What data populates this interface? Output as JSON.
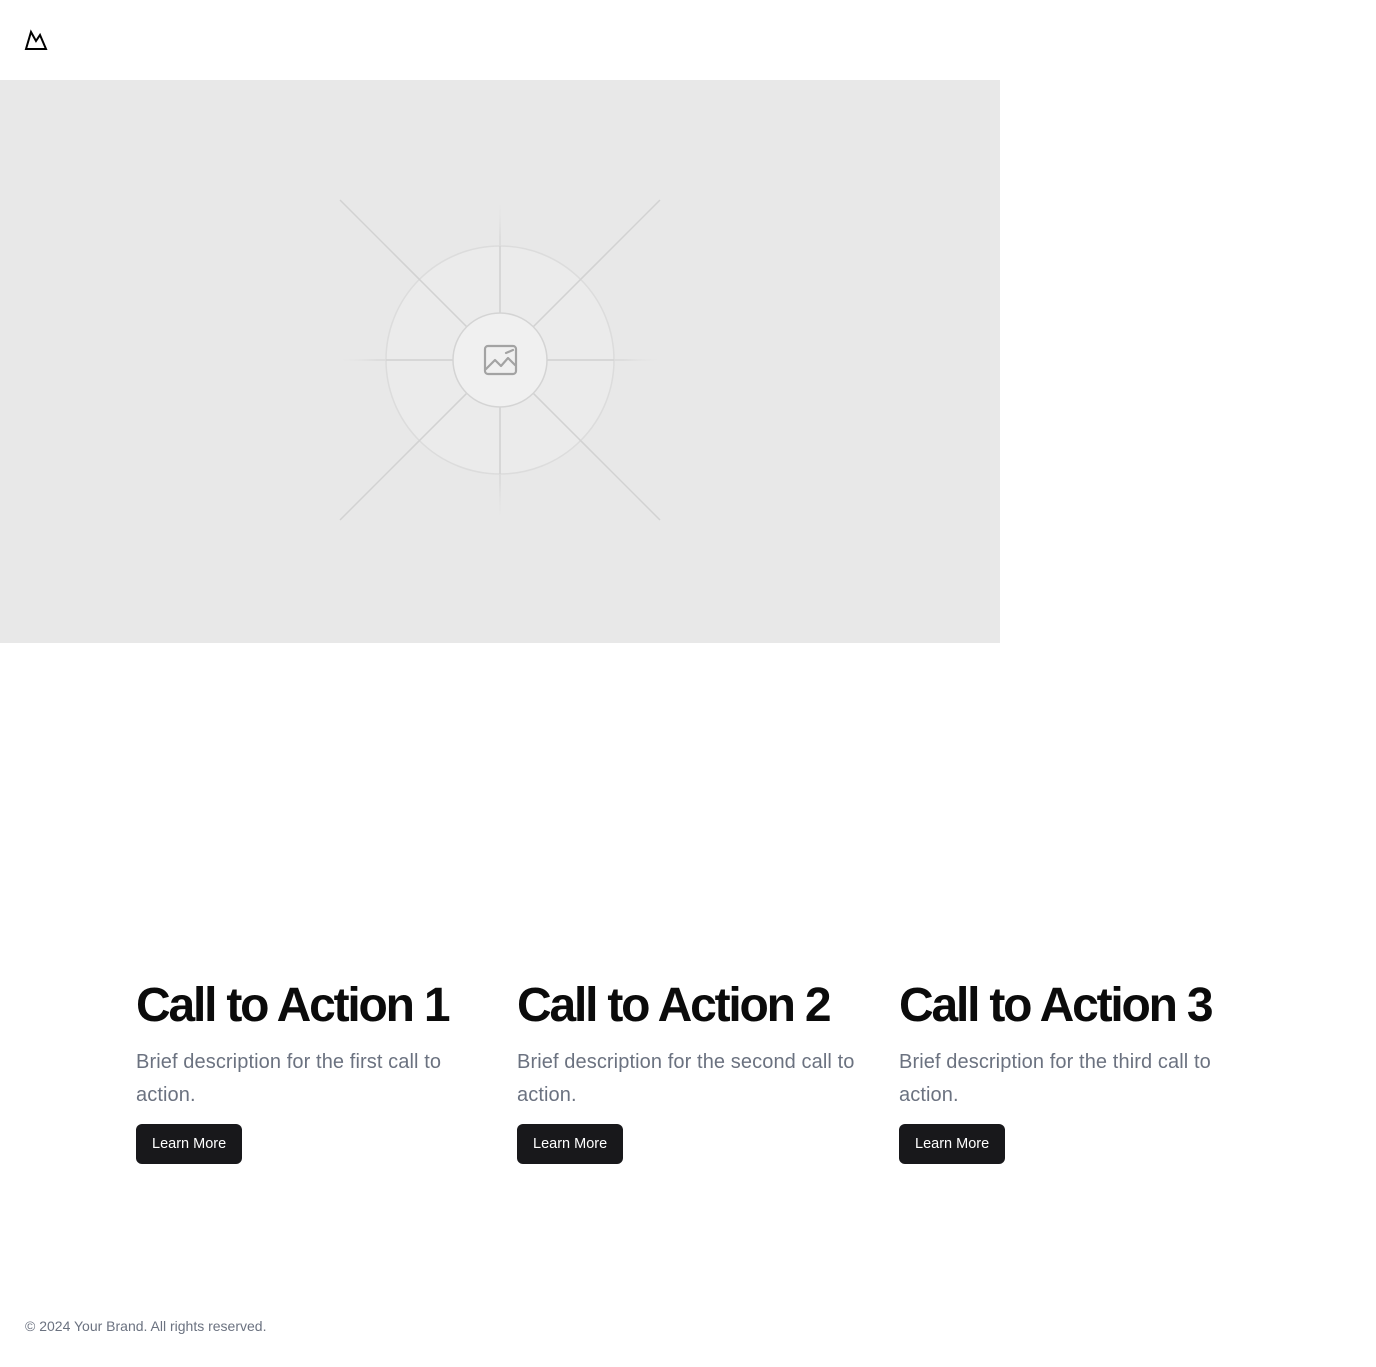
{
  "header": {
    "logo_icon": "mountain-logo-icon"
  },
  "hero": {
    "placeholder_icon": "image-placeholder-icon",
    "background_color": "#e8e8e8"
  },
  "ctas": [
    {
      "title": "Call to Action 1",
      "description": "Brief description for the first call to action.",
      "button_label": "Learn More"
    },
    {
      "title": "Call to Action 2",
      "description": "Brief description for the second call to action.",
      "button_label": "Learn More"
    },
    {
      "title": "Call to Action 3",
      "description": "Brief description for the third call to action.",
      "button_label": "Learn More"
    }
  ],
  "footer": {
    "copyright": "© 2024 Your Brand. All rights reserved."
  },
  "colors": {
    "button_bg": "#18181b",
    "description_text": "#6b7280",
    "title_text": "#0b0b0b"
  }
}
